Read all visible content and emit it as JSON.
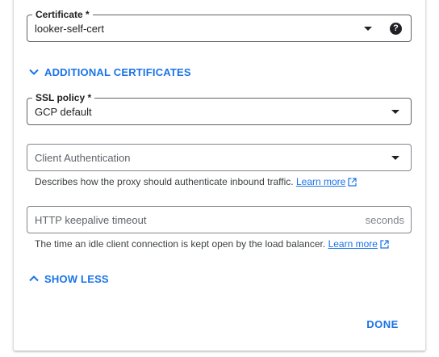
{
  "certificate": {
    "label": "Certificate *",
    "value": "looker-self-cert",
    "help_icon": "?"
  },
  "additional_certificates": {
    "label": "ADDITIONAL CERTIFICATES",
    "icon": "chevron-down-icon"
  },
  "ssl_policy": {
    "label": "SSL policy *",
    "value": "GCP default"
  },
  "client_auth": {
    "placeholder": "Client Authentication",
    "hint": "Describes how the proxy should authenticate inbound traffic.",
    "learn_more": "Learn more"
  },
  "keepalive": {
    "placeholder": "HTTP keepalive timeout",
    "suffix": "seconds",
    "hint": "The time an idle client connection is kept open by the load balancer.",
    "learn_more": "Learn more"
  },
  "show_less": {
    "label": "SHOW LESS",
    "icon": "chevron-up-icon"
  },
  "done": {
    "label": "DONE"
  },
  "colors": {
    "accent": "#1a73e8",
    "border": "#80868b",
    "text": "#202124"
  }
}
